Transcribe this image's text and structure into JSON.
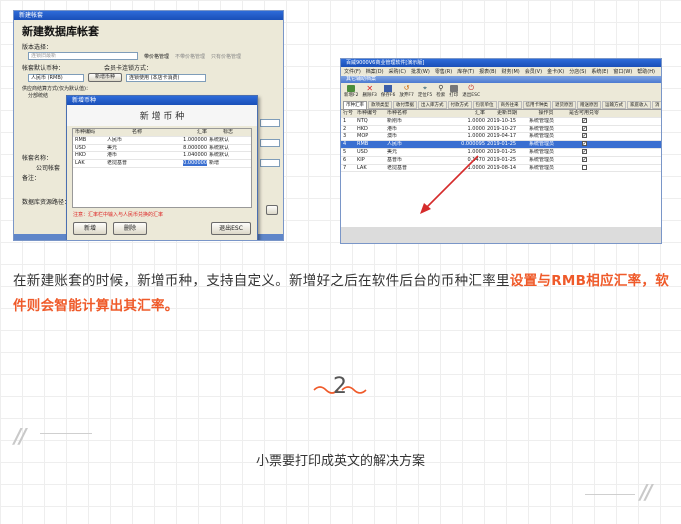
{
  "left_window": {
    "title": "新建帐套",
    "heading": "新建数据库帐套",
    "version_label": "版本选择：",
    "version_value": "连锁旧最新",
    "radio_options": [
      "带价格管理",
      "不带价格管理",
      "只有价格管理"
    ],
    "default_currency_label": "帐套默认币种：",
    "default_currency_value": "人民币 (RMB)",
    "new_currency_btn": "新增币种",
    "membership_label": "会员卡连锁方式：",
    "membership_value": "连锁使用 (本店卡消费)",
    "supplier_label": "供应商结算方式(仅为默认值)：",
    "supplier_option": "分部统结",
    "account_name_label": "帐套名称：",
    "company_label": "公司帐套",
    "remark_label": "备注：",
    "db_path_label": "数据库资源路径："
  },
  "currency_dialog": {
    "title": "新增币种",
    "heading": "新 增 币 种",
    "columns": [
      "币种编码",
      "名称",
      "汇率",
      "标志"
    ],
    "rows": [
      {
        "code": "RMB",
        "name": "人民币",
        "rate": "1.000000",
        "flag": "系统默认"
      },
      {
        "code": "USD",
        "name": "美元",
        "rate": "8.000000",
        "flag": "系统默认"
      },
      {
        "code": "HKD",
        "name": "港币",
        "rate": "1.040000",
        "flag": "系统默认"
      },
      {
        "code": "LAK",
        "name": "老挝基普",
        "rate": "0.000000",
        "flag": "新增"
      }
    ],
    "note": "注意：汇率栏中输入与人民币兑换的汇率",
    "buttons": {
      "add": "新增",
      "delete": "删除",
      "exit": "退出ESC"
    }
  },
  "right_window": {
    "title": "百威9000V6商业管理软件[演示版]",
    "menu": [
      "文件(F)",
      "档案(D)",
      "采购(C)",
      "批发(W)",
      "零售(R)",
      "库存(T)",
      "报表(B)",
      "财务(M)",
      "会员(V)",
      "金卡(K)",
      "分店(S)",
      "系统(E)",
      "窗口(W)",
      "帮助(H)"
    ],
    "subwin_title": "其它辅助档案",
    "toolbar": [
      "新增F2",
      "删除F3",
      "保存F6",
      "放弃F7",
      "定位F5",
      "检索",
      "打印",
      "退出ESC"
    ],
    "tabs": [
      "币种汇率",
      "款项类型",
      "收付票据",
      "出入库方式",
      "付款方式",
      "包装单位",
      "商务往来",
      "信用卡种类",
      "退货原因",
      "赠送原因",
      "运输方式",
      "家庭收入",
      "消"
    ],
    "columns": [
      "行号",
      "币种编号",
      "币种名称",
      "汇率",
      "更新日期",
      "操作员",
      "是否可用兑零"
    ],
    "rows": [
      {
        "no": "1",
        "code": "NTQ",
        "name": "新刚币",
        "rate": "1.0000",
        "date": "2019-10-15",
        "op": "系统管理员",
        "check": true
      },
      {
        "no": "2",
        "code": "HKD",
        "name": "港币",
        "rate": "1.0000",
        "date": "2019-10-27",
        "op": "系统管理员",
        "check": true
      },
      {
        "no": "3",
        "code": "MOP",
        "name": "澳币",
        "rate": "1.0000",
        "date": "2019-04-17",
        "op": "系统管理员",
        "check": true
      },
      {
        "no": "4",
        "code": "RMB",
        "name": "人民币",
        "rate": "0.000095",
        "date": "2019-01-25",
        "op": "系统管理员",
        "check": true
      },
      {
        "no": "5",
        "code": "USD",
        "name": "美元",
        "rate": "1.0000",
        "date": "2019-01-25",
        "op": "系统管理员",
        "check": true
      },
      {
        "no": "6",
        "code": "KIP",
        "name": "基普币",
        "rate": "0.1470",
        "date": "2019-01-25",
        "op": "系统管理员",
        "check": true
      },
      {
        "no": "7",
        "code": "LAK",
        "name": "老挝基普",
        "rate": "1.0000",
        "date": "2019-08-14",
        "op": "系统管理员",
        "check": false
      }
    ]
  },
  "paragraph": {
    "normal": "在新建账套的时候，新增币种，支持自定义。新增好之后在软件后台的币种汇率里",
    "highlight": "设置与RMB相应汇率，软件则会智能计算出其汇率。"
  },
  "section": {
    "number": "2",
    "title": "小票要打印成英文的解决方案"
  },
  "colors": {
    "accent": "#ef5a2a",
    "xp_title": "#1a4fb8",
    "selection": "#3a6fd1",
    "arrow": "#d52b2b"
  }
}
